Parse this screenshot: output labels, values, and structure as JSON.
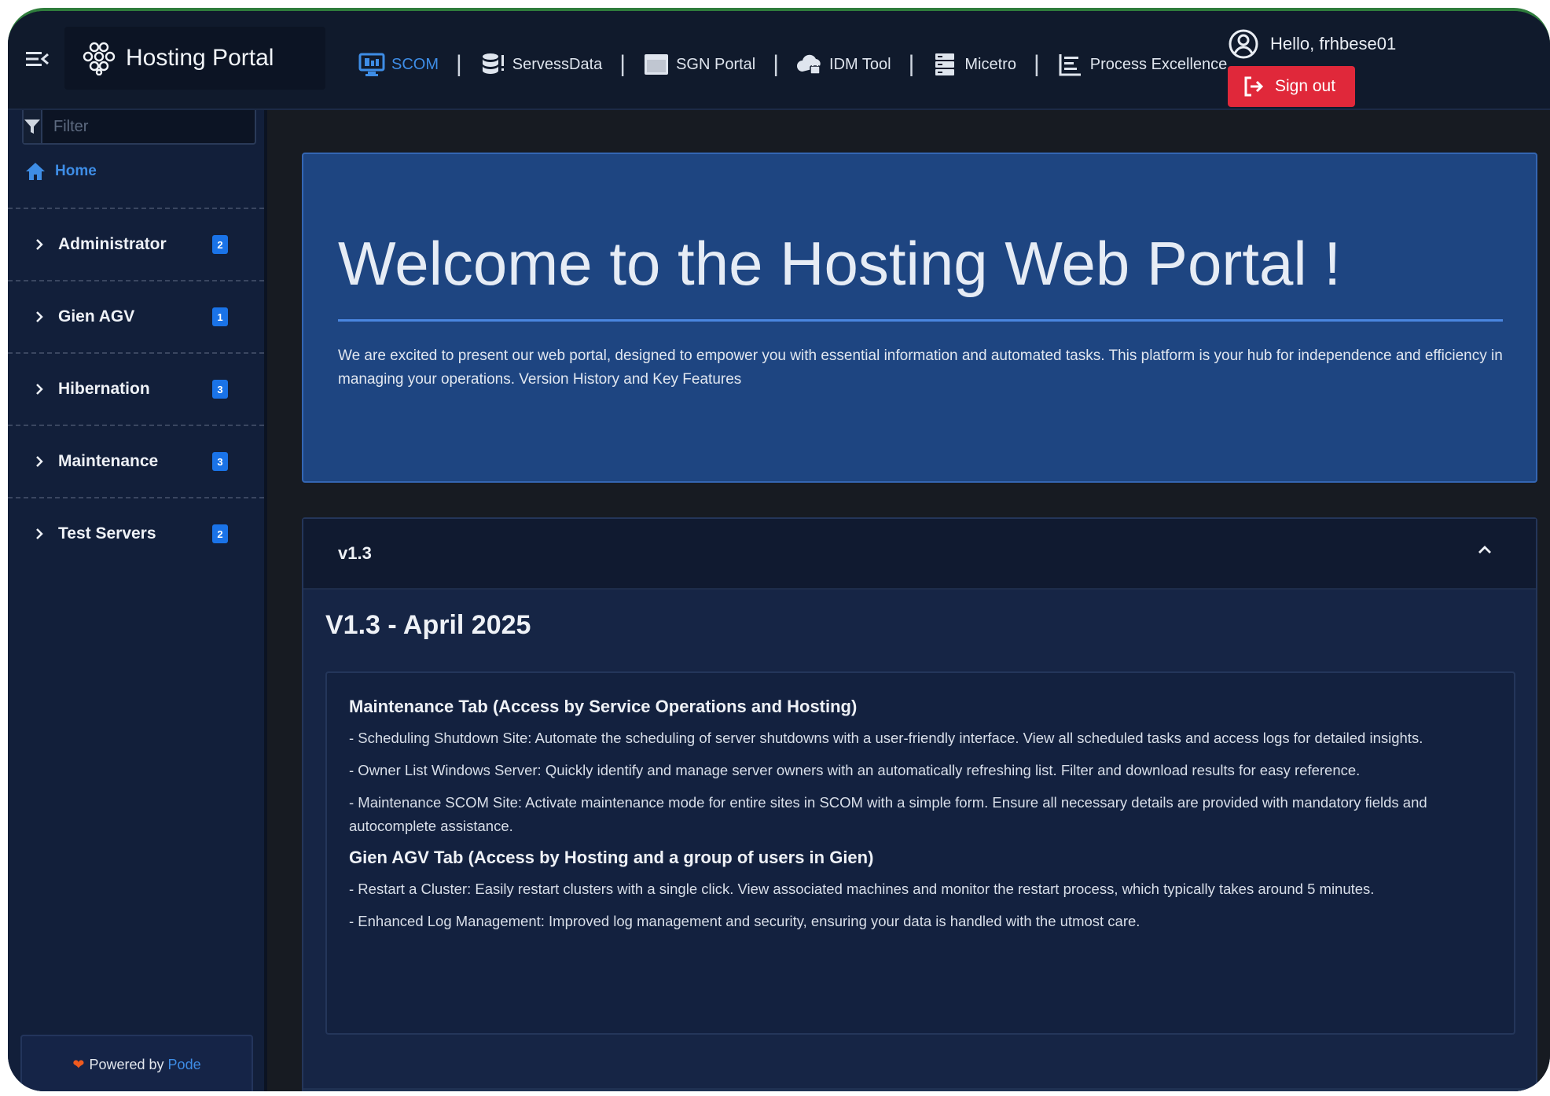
{
  "header": {
    "brand_title": "Hosting Portal",
    "nav": [
      {
        "label": "SCOM",
        "icon": "monitor-icon",
        "active": true
      },
      {
        "label": "ServessData",
        "icon": "database-icon",
        "active": false
      },
      {
        "label": "SGN Portal",
        "icon": "window-icon",
        "active": false
      },
      {
        "label": "IDM Tool",
        "icon": "cloud-lock-icon",
        "active": false
      },
      {
        "label": "Micetro",
        "icon": "server-icon",
        "active": false
      },
      {
        "label": "Process Excellence",
        "icon": "chart-list-icon",
        "active": false
      }
    ],
    "separator": "|",
    "greeting": "Hello, frhbese01",
    "signout_label": "Sign out"
  },
  "sidebar": {
    "filter_placeholder": "Filter",
    "home_label": "Home",
    "groups": [
      {
        "label": "Administrator",
        "count": "2"
      },
      {
        "label": "Gien AGV",
        "count": "1"
      },
      {
        "label": "Hibernation",
        "count": "3"
      },
      {
        "label": "Maintenance",
        "count": "3"
      },
      {
        "label": "Test Servers",
        "count": "2"
      }
    ],
    "powered_by": "Powered by",
    "powered_link": "Pode"
  },
  "hero": {
    "title": "Welcome to the Hosting Web Portal !",
    "text": "We are excited to present our web portal, designed to empower you with essential information and automated tasks. This platform is your hub for independence and efficiency in managing your operations. Version History and Key Features"
  },
  "release": {
    "header_label": "v1.3",
    "title": "V1.3 - April 2025",
    "sections": [
      {
        "heading": "Maintenance Tab (Access by Service Operations and Hosting)",
        "items": [
          "- Scheduling Shutdown Site: Automate the scheduling of server shutdowns with a user-friendly interface. View all scheduled tasks and access logs for detailed insights.",
          "- Owner List Windows Server: Quickly identify and manage server owners with an automatically refreshing list. Filter and download results for easy reference.",
          "- Maintenance SCOM Site: Activate maintenance mode for entire sites in SCOM with a simple form. Ensure all necessary details are provided with mandatory fields and autocomplete assistance."
        ]
      },
      {
        "heading": "Gien AGV Tab (Access by Hosting and a group of users in Gien)",
        "items": [
          "- Restart a Cluster: Easily restart clusters with a single click. View associated machines and monitor the restart process, which typically takes around 5 minutes.",
          "- Enhanced Log Management: Improved log management and security, ensuring your data is handled with the utmost care."
        ]
      }
    ]
  },
  "colors": {
    "accent": "#3e8de6",
    "signout": "#e0283a",
    "badge": "#1a73e8",
    "hero": "#1e4581"
  }
}
